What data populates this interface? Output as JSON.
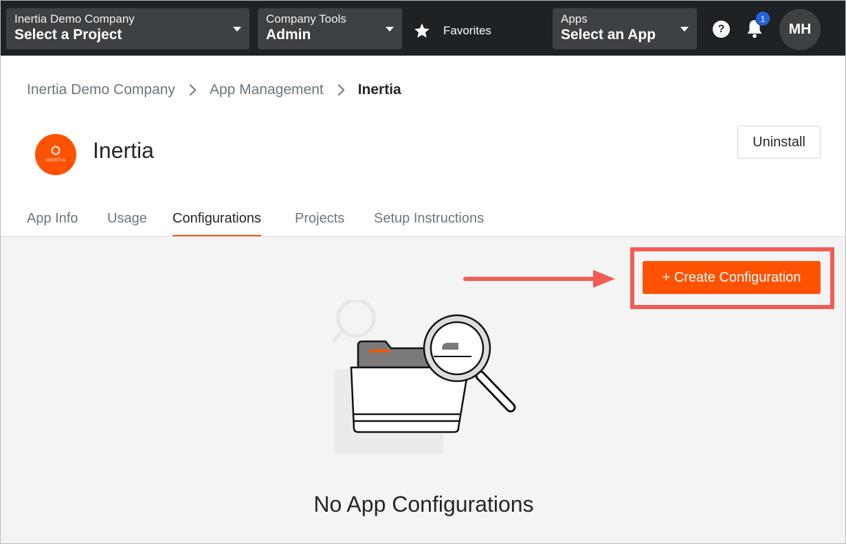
{
  "topnav": {
    "project": {
      "label": "Inertia Demo Company",
      "value": "Select a Project"
    },
    "tools": {
      "label": "Company Tools",
      "value": "Admin"
    },
    "favorites_label": "Favorites",
    "apps": {
      "label": "Apps",
      "value": "Select an App"
    },
    "help_glyph": "?",
    "notification_count": "1",
    "avatar_initials": "MH"
  },
  "breadcrumb": {
    "items": [
      "Inertia Demo Company",
      "App Management",
      "Inertia"
    ]
  },
  "app": {
    "title": "Inertia",
    "logo_text": "INERTIA",
    "uninstall_label": "Uninstall"
  },
  "tabs": [
    {
      "label": "App Info",
      "active": false
    },
    {
      "label": "Usage",
      "active": false
    },
    {
      "label": "Configurations",
      "active": true
    },
    {
      "label": "Projects",
      "active": false
    },
    {
      "label": "Setup Instructions",
      "active": false
    }
  ],
  "main": {
    "create_label": "+ Create Configuration",
    "empty_title": "No App Configurations"
  },
  "colors": {
    "accent": "#ff5200",
    "nav_bg": "#1f2224",
    "highlight": "#f25c54",
    "badge": "#2066df"
  },
  "icons": [
    "chevron-down-icon",
    "star-icon",
    "help-icon",
    "bell-icon",
    "chevron-right-icon",
    "folder-search-illustration",
    "annotation-arrow"
  ]
}
